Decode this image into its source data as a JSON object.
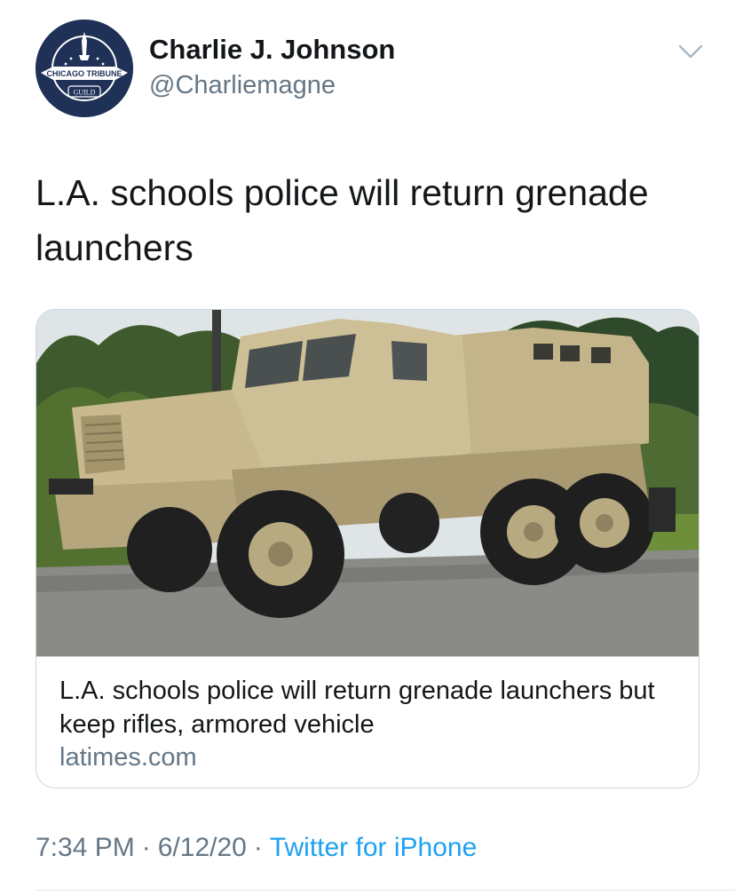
{
  "author": {
    "display_name": "Charlie J. Johnson",
    "handle": "@Charliemagne",
    "avatar": {
      "icon": "chicago-tribune-guild-logo",
      "line1": "CHICAGO TRIBUNE",
      "line2": "GUILD"
    }
  },
  "menu": {
    "icon": "chevron-down-icon"
  },
  "tweet": {
    "text": "L.A. schools police will return grenade launchers"
  },
  "card": {
    "image": "armored-vehicle-photo",
    "title": "L.A. schools police will return grenade launchers but keep rifles, armored vehicle",
    "domain": "latimes.com"
  },
  "meta": {
    "time": "7:34 PM",
    "separator": "·",
    "date": "6/12/20",
    "source": "Twitter for iPhone"
  },
  "colors": {
    "text": "#14171a",
    "secondary": "#657786",
    "link": "#1da1f2",
    "border": "#ccd6dd",
    "avatar_bg": "#1f3156"
  }
}
